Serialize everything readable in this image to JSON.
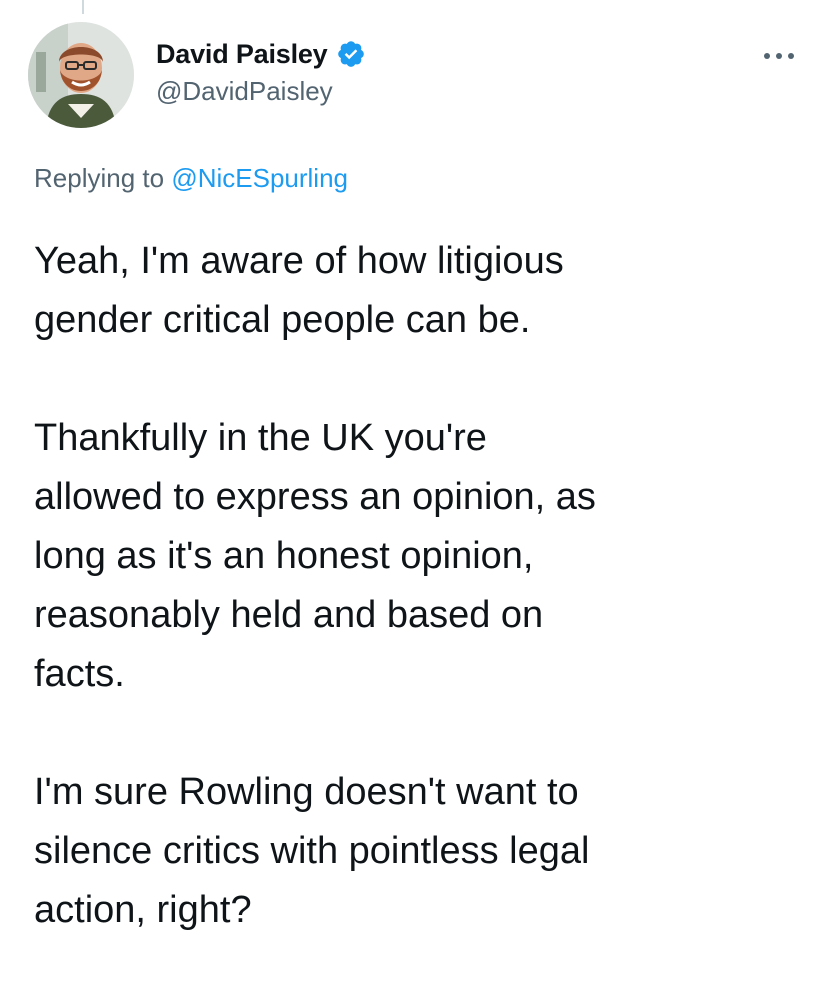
{
  "tweet": {
    "author": {
      "display_name": "David Paisley",
      "handle": "@DavidPaisley",
      "verified": true,
      "avatar_icon": "bearded-man-avatar"
    },
    "more_icon": "ellipsis-icon",
    "reply": {
      "prefix": "Replying to",
      "to_handle": "@NicESpurling"
    },
    "paragraphs": [
      "Yeah, I'm aware of how litigious\ngender critical people can be.",
      "Thankfully in the UK you're\nallowed to express an opinion, as\nlong as it's an honest opinion,\nreasonably held and based on\nfacts.",
      "I'm sure Rowling doesn't want to\nsilence critics with pointless legal\naction, right?"
    ]
  },
  "colors": {
    "text": "#0f1419",
    "secondary": "#536471",
    "link": "#1d9bf0",
    "verified": "#1d9bf0"
  }
}
